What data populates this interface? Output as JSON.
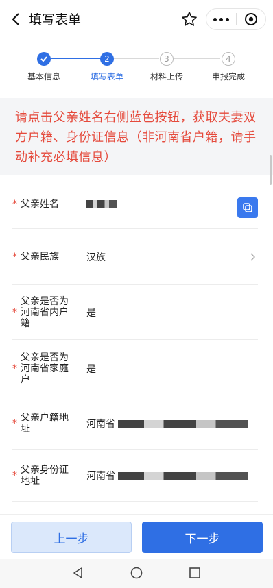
{
  "nav": {
    "title": "填写表单"
  },
  "steps": [
    {
      "number": "1",
      "label": "基本信息",
      "state": "done"
    },
    {
      "number": "2",
      "label": "填写表单",
      "state": "active"
    },
    {
      "number": "3",
      "label": "材料上传",
      "state": "todo"
    },
    {
      "number": "4",
      "label": "申报完成",
      "state": "todo"
    }
  ],
  "notice": {
    "text": "请点击父亲姓名右侧蓝色按钮，获取夫妻双方户籍、身份证信息（非河南省户籍，请手动补充必填信息）"
  },
  "form": {
    "rows": [
      {
        "label": "父亲姓名",
        "value": "",
        "required": "*"
      },
      {
        "label": "父亲民族",
        "value": "汉族",
        "required": "*"
      },
      {
        "label": "父亲是否为河南省内户籍",
        "value": "是",
        "required": "*"
      },
      {
        "label": "父亲是否为河南省家庭户",
        "value": "是",
        "required": "*"
      },
      {
        "label": "父亲户籍地址",
        "value": "河南省",
        "required": "*"
      },
      {
        "label": "父亲身份证地址",
        "value": "河南省",
        "required": "*"
      }
    ]
  },
  "buttons": {
    "prev": "上一步",
    "next": "下一步"
  },
  "colors": {
    "primary": "#2f6fe4",
    "warning": "#e54a3c"
  }
}
